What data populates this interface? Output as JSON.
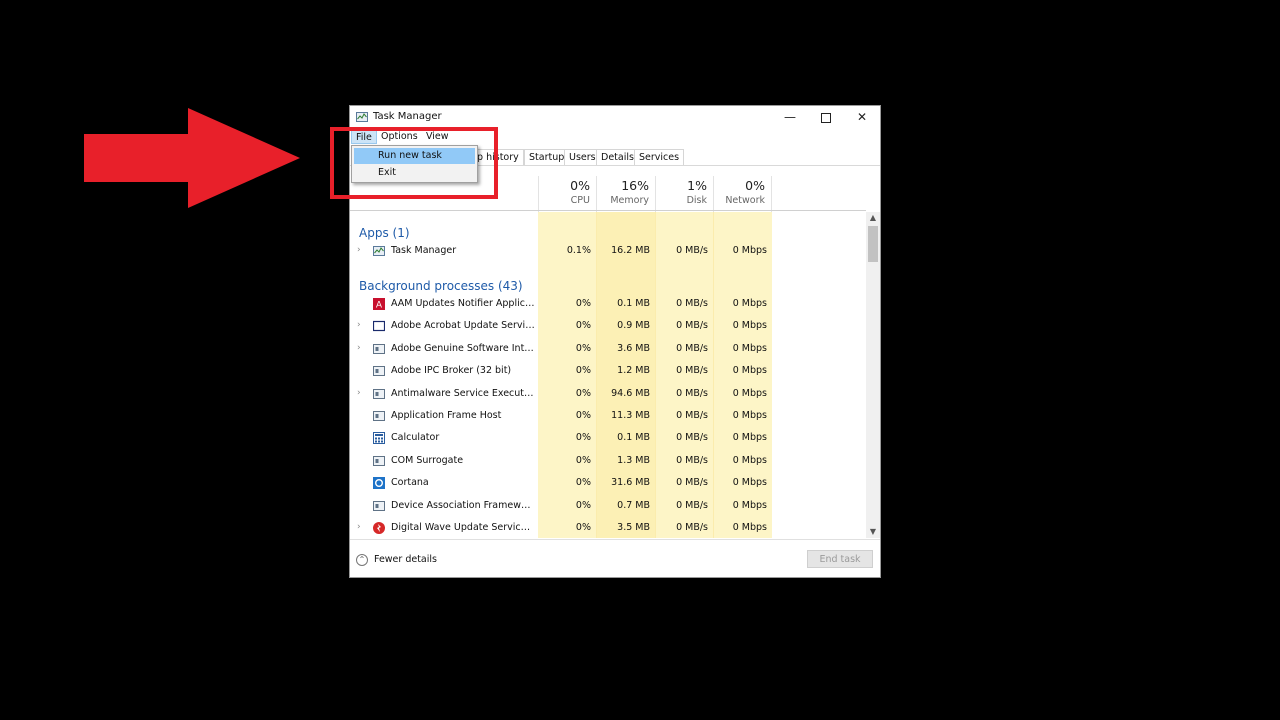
{
  "window": {
    "title": "Task Manager",
    "controls": {
      "minimize": "—",
      "close": "✕"
    }
  },
  "menubar": {
    "file": "File",
    "options": "Options",
    "view": "View"
  },
  "file_menu": {
    "run_new_task": "Run new task",
    "exit": "Exit"
  },
  "tabs": [
    "pp history",
    "Startup",
    "Users",
    "Details",
    "Services"
  ],
  "columns": {
    "cpu": {
      "pct": "0%",
      "label": "CPU"
    },
    "memory": {
      "pct": "16%",
      "label": "Memory"
    },
    "disk": {
      "pct": "1%",
      "label": "Disk"
    },
    "network": {
      "pct": "0%",
      "label": "Network"
    }
  },
  "groups": {
    "apps": "Apps (1)",
    "background": "Background processes (43)"
  },
  "apps": [
    {
      "name": "Task Manager",
      "expandable": true,
      "icon": "task-manager-icon",
      "cpu": "0.1%",
      "memory": "16.2 MB",
      "disk": "0 MB/s",
      "network": "0 Mbps"
    }
  ],
  "background": [
    {
      "name": "AAM Updates Notifier Applicati...",
      "expandable": false,
      "icon": "adobe-red-icon",
      "cpu": "0%",
      "memory": "0.1 MB",
      "disk": "0 MB/s",
      "network": "0 Mbps"
    },
    {
      "name": "Adobe Acrobat Update Service (...",
      "expandable": true,
      "icon": "window-icon",
      "cpu": "0%",
      "memory": "0.9 MB",
      "disk": "0 MB/s",
      "network": "0 Mbps"
    },
    {
      "name": "Adobe Genuine Software Integri...",
      "expandable": true,
      "icon": "service-icon",
      "cpu": "0%",
      "memory": "3.6 MB",
      "disk": "0 MB/s",
      "network": "0 Mbps"
    },
    {
      "name": "Adobe IPC Broker (32 bit)",
      "expandable": false,
      "icon": "service-icon",
      "cpu": "0%",
      "memory": "1.2 MB",
      "disk": "0 MB/s",
      "network": "0 Mbps"
    },
    {
      "name": "Antimalware Service Executable",
      "expandable": true,
      "icon": "service-icon",
      "cpu": "0%",
      "memory": "94.6 MB",
      "disk": "0 MB/s",
      "network": "0 Mbps"
    },
    {
      "name": "Application Frame Host",
      "expandable": false,
      "icon": "service-icon",
      "cpu": "0%",
      "memory": "11.3 MB",
      "disk": "0 MB/s",
      "network": "0 Mbps"
    },
    {
      "name": "Calculator",
      "expandable": false,
      "icon": "calculator-icon",
      "cpu": "0%",
      "memory": "0.1 MB",
      "disk": "0 MB/s",
      "network": "0 Mbps"
    },
    {
      "name": "COM Surrogate",
      "expandable": false,
      "icon": "service-icon",
      "cpu": "0%",
      "memory": "1.3 MB",
      "disk": "0 MB/s",
      "network": "0 Mbps"
    },
    {
      "name": "Cortana",
      "expandable": false,
      "icon": "cortana-icon",
      "cpu": "0%",
      "memory": "31.6 MB",
      "disk": "0 MB/s",
      "network": "0 Mbps"
    },
    {
      "name": "Device Association Framework ...",
      "expandable": false,
      "icon": "service-icon",
      "cpu": "0%",
      "memory": "0.7 MB",
      "disk": "0 MB/s",
      "network": "0 Mbps"
    },
    {
      "name": "Digital Wave Update Service (32...",
      "expandable": true,
      "icon": "digital-wave-icon",
      "cpu": "0%",
      "memory": "3.5 MB",
      "disk": "0 MB/s",
      "network": "0 Mbps"
    }
  ],
  "footer": {
    "fewer_details": "Fewer details",
    "end_task": "End task"
  },
  "annotation": {
    "arrow_color": "#e8202a",
    "box_color": "#e8202a"
  }
}
